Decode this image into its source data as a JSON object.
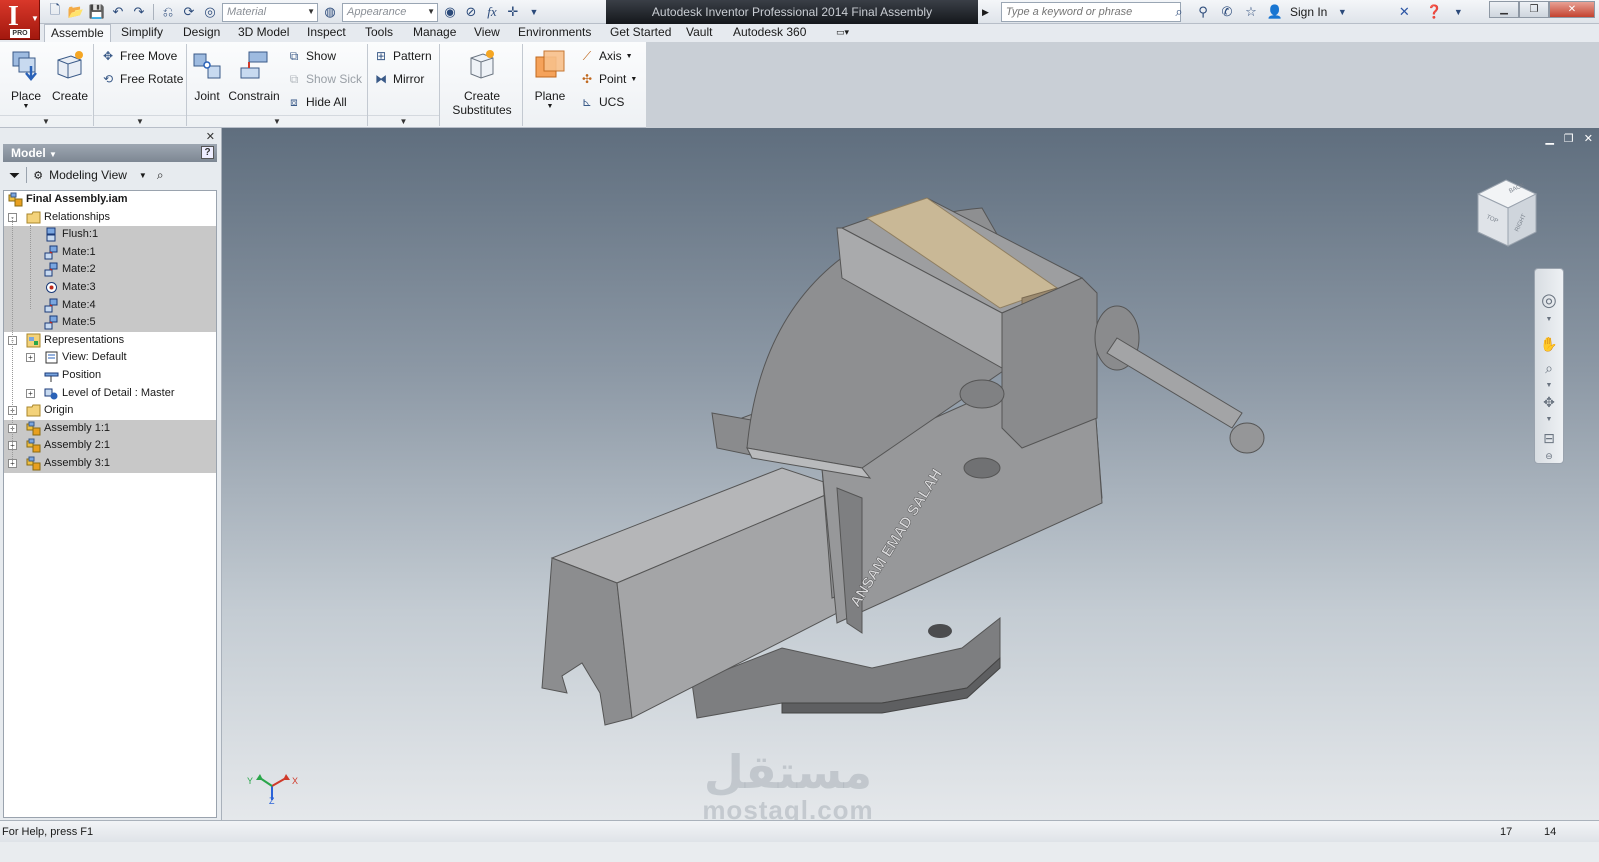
{
  "app": {
    "badge": "PRO",
    "title": "Autodesk Inventor Professional 2014    Final Assembly"
  },
  "qat": {
    "material_placeholder": "Material",
    "appearance_placeholder": "Appearance",
    "fx_label": "fx"
  },
  "search": {
    "placeholder": "Type a keyword or phrase",
    "sign_in": "Sign In"
  },
  "tabs": [
    {
      "label": "Assemble",
      "active": true
    },
    {
      "label": "Simplify"
    },
    {
      "label": "Design"
    },
    {
      "label": "3D Model"
    },
    {
      "label": "Inspect"
    },
    {
      "label": "Tools"
    },
    {
      "label": "Manage"
    },
    {
      "label": "View"
    },
    {
      "label": "Environments"
    },
    {
      "label": "Get Started"
    },
    {
      "label": "Vault"
    },
    {
      "label": "Autodesk 360"
    }
  ],
  "ribbon": {
    "place": "Place",
    "create": "Create",
    "free_move": "Free Move",
    "free_rotate": "Free Rotate",
    "joint": "Joint",
    "constrain": "Constrain",
    "show": "Show",
    "show_sick": "Show Sick",
    "hide_all": "Hide All",
    "pattern": "Pattern",
    "mirror": "Mirror",
    "create_substitutes_1": "Create",
    "create_substitutes_2": "Substitutes",
    "plane": "Plane",
    "axis": "Axis",
    "point": "Point",
    "ucs": "UCS"
  },
  "browser": {
    "header": "Model",
    "view_mode": "Modeling View",
    "tree": [
      {
        "label": "Final Assembly.iam",
        "level": 0,
        "bold": true,
        "icon": "assembly-icon",
        "expander": ""
      },
      {
        "label": "Relationships",
        "level": 0,
        "icon": "folder-icon",
        "expander": "-"
      },
      {
        "label": "Flush:1",
        "level": 1,
        "icon": "flush-constraint-icon",
        "highlight": true
      },
      {
        "label": "Mate:1",
        "level": 1,
        "icon": "mate-constraint-icon",
        "highlight": true
      },
      {
        "label": "Mate:2",
        "level": 1,
        "icon": "mate-constraint-icon",
        "highlight": true
      },
      {
        "label": "Mate:3",
        "level": 1,
        "icon": "mate-point-constraint-icon",
        "highlight": true
      },
      {
        "label": "Mate:4",
        "level": 1,
        "icon": "mate-constraint-icon",
        "highlight": true
      },
      {
        "label": "Mate:5",
        "level": 1,
        "icon": "mate-constraint-icon",
        "highlight": true
      },
      {
        "label": "Representations",
        "level": 0,
        "icon": "representations-icon",
        "expander": "-"
      },
      {
        "label": "View: Default",
        "level": 1,
        "icon": "view-rep-icon",
        "expander": "+"
      },
      {
        "label": "Position",
        "level": 1,
        "icon": "position-rep-icon"
      },
      {
        "label": "Level of Detail : Master",
        "level": 1,
        "icon": "lod-rep-icon",
        "expander": "+"
      },
      {
        "label": "Origin",
        "level": 0,
        "icon": "folder-icon",
        "expander": "+"
      },
      {
        "label": "Assembly 1:1",
        "level": 0,
        "icon": "subassembly-icon",
        "expander": "+",
        "highlight": true
      },
      {
        "label": "Assembly 2:1",
        "level": 0,
        "icon": "subassembly-icon",
        "expander": "+",
        "highlight": true
      },
      {
        "label": "Assembly 3:1",
        "level": 0,
        "icon": "subassembly-icon",
        "expander": "+",
        "highlight": true
      }
    ]
  },
  "viewcube": {
    "back": "BACK",
    "top": "TOP",
    "right": "RIGHT"
  },
  "model": {
    "engraving": "ANSAM EMAD SALAH"
  },
  "triad": {
    "x": "X",
    "y": "Y",
    "z": "Z"
  },
  "watermark": {
    "arabic": "مستقل",
    "latin": "mostaql.com"
  },
  "status": {
    "help": "For Help, press F1",
    "count_a": "17",
    "count_b": "14"
  },
  "colors": {
    "app_red": "#c0281a",
    "highlight_row": "#c8c8c8",
    "part_gray": "#8a8a8c",
    "jaw_insert": "#c9b896"
  }
}
